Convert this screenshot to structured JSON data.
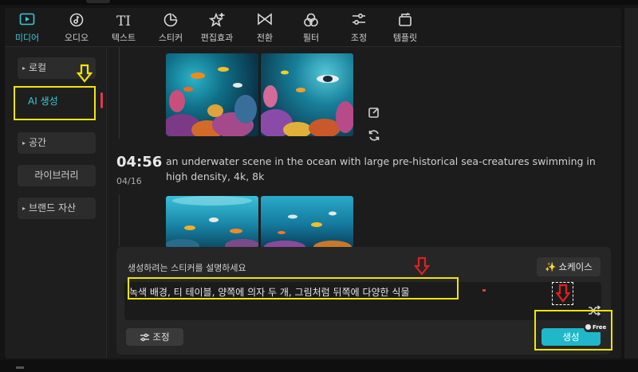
{
  "toolbar": {
    "items": [
      {
        "label": "미디어",
        "icon": "media-icon",
        "active": true
      },
      {
        "label": "오디오",
        "icon": "audio-icon"
      },
      {
        "label": "텍스트",
        "icon": "text-icon",
        "glyph": "TI"
      },
      {
        "label": "스티커",
        "icon": "sticker-icon"
      },
      {
        "label": "편집효과",
        "icon": "effects-icon"
      },
      {
        "label": "전환",
        "icon": "transition-icon"
      },
      {
        "label": "필터",
        "icon": "filter-icon"
      },
      {
        "label": "조정",
        "icon": "adjust-icon"
      },
      {
        "label": "템플릿",
        "icon": "template-icon"
      }
    ]
  },
  "sidebar": {
    "items": [
      {
        "label": "로컬",
        "expandable": true
      },
      {
        "label": "AI 생성",
        "active": true
      },
      {
        "label": "공간",
        "expandable": true
      },
      {
        "label": "라이브러리"
      },
      {
        "label": "브랜드 자산",
        "expandable": true
      }
    ]
  },
  "history": {
    "entry": {
      "time": "04:56",
      "date": "04/16",
      "prompt": "an underwater scene in the ocean with large pre-historical sea-creatures swimming in high density, 4k, 8k"
    }
  },
  "panel": {
    "title": "생성하려는 스티커를 설명하세요",
    "showcase_label": "쇼케이스",
    "input_value": "녹색 배경, 티 테이블, 양쪽에 의자 두 개, 그림처럼 뒤쪽에 다양한 식물",
    "adjust_label": "조정",
    "generate_label": "생성",
    "free_badge": "Free"
  },
  "colors": {
    "accent": "#1fb7c9",
    "active_text": "#3bc7d6",
    "highlight": "#f2e600",
    "arrow_red": "#e02020"
  }
}
